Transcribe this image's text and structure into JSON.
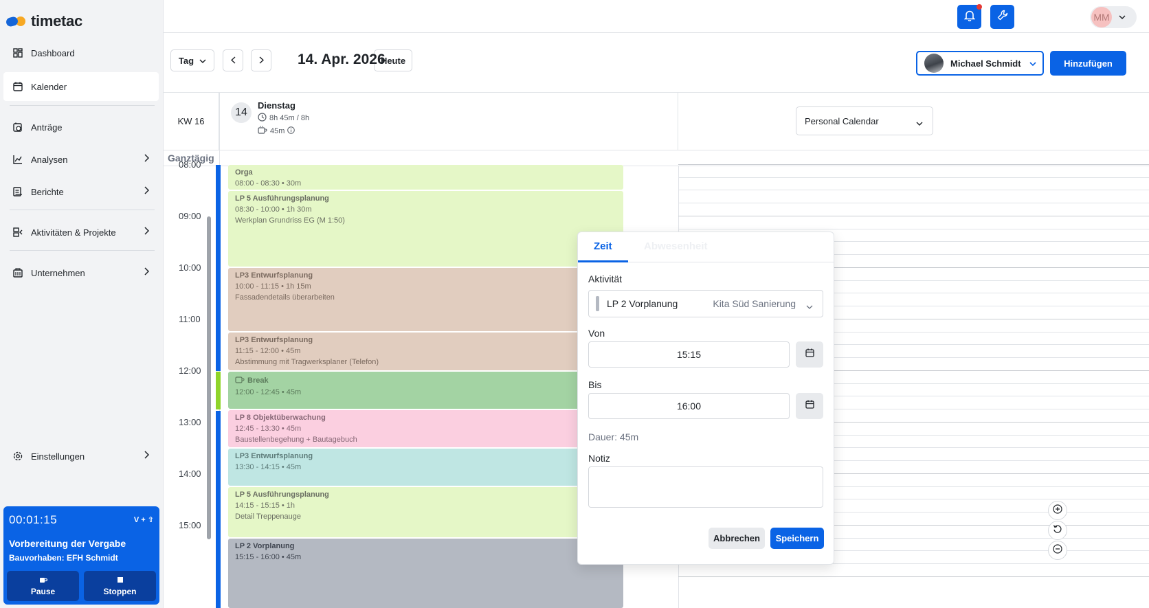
{
  "app": {
    "name": "timetac"
  },
  "sidebar": {
    "items": [
      {
        "label": "Dashboard",
        "icon": "dashboard-icon"
      },
      {
        "label": "Kalender",
        "icon": "calendar-icon"
      },
      {
        "label": "Anträge",
        "icon": "request-icon"
      },
      {
        "label": "Analysen",
        "icon": "chart-icon"
      },
      {
        "label": "Berichte",
        "icon": "report-icon"
      },
      {
        "label": "Aktivitäten & Projekte",
        "icon": "projects-icon"
      },
      {
        "label": "Unternehmen",
        "icon": "company-icon"
      },
      {
        "label": "Einstellungen",
        "icon": "settings-icon"
      }
    ]
  },
  "timer": {
    "elapsed": "00:01:15",
    "shortcut": "V + ⇧",
    "task": "Vorbereitung der Vergabe",
    "project": "Bauvorhaben: EFH Schmidt",
    "pause_label": "Pause",
    "stop_label": "Stoppen"
  },
  "topbar": {
    "user_initials": "MM"
  },
  "toolbar": {
    "view": "Tag",
    "date": "14. Apr. 2026",
    "today_label": "Heute",
    "user_name": "Michael Schmidt",
    "add_label": "Hinzufügen"
  },
  "calendar": {
    "week": "KW 16",
    "day_number": "14",
    "day_name": "Dienstag",
    "hours_summary": "8h 45m / 8h",
    "break_summary": "45m",
    "calendar_select": "Personal Calendar",
    "allday_label": "Ganztägig",
    "hours": [
      "08:00",
      "09:00",
      "10:00",
      "11:00",
      "12:00",
      "13:00",
      "14:00",
      "15:00"
    ],
    "events": [
      {
        "title": "Orga",
        "time": "08:00 - 08:30 • 30m",
        "note": "",
        "style": "green"
      },
      {
        "title": "LP 5 Ausführungsplanung",
        "time": "08:30 - 10:00 • 1h 30m",
        "note": "Werkplan Grundriss EG (M 1:50)",
        "style": "green"
      },
      {
        "title": "LP3 Entwurfsplanung",
        "time": "10:00 - 11:15 • 1h 15m",
        "note": "Fassadendetails überarbeiten",
        "style": "brown"
      },
      {
        "title": "LP3 Entwurfsplanung",
        "time": "11:15 - 12:00 • 45m",
        "note": "Abstimmung mit Tragwerksplaner (Telefon)",
        "style": "brown"
      },
      {
        "title": "Break",
        "time": "12:00 - 12:45 • 45m",
        "note": "",
        "style": "break"
      },
      {
        "title": "LP 8 Objektüberwachung",
        "time": "12:45 - 13:30 • 45m",
        "note": "Baustellenbegehung + Bautagebuch",
        "style": "pink"
      },
      {
        "title": "LP3 Entwurfsplanung",
        "time": "13:30 - 14:15 • 45m",
        "note": "",
        "style": "teal"
      },
      {
        "title": "LP 5 Ausführungsplanung",
        "time": "14:15 - 15:15 • 1h",
        "note": "Detail Treppenauge",
        "style": "green"
      },
      {
        "title": "LP 2 Vorplanung",
        "time": "15:15 - 16:00 • 45m",
        "note": "",
        "style": "gray"
      }
    ]
  },
  "popup": {
    "tab_time": "Zeit",
    "tab_absence": "Abwesenheit",
    "activity_label": "Aktivität",
    "activity_value": "LP 2 Vorplanung",
    "activity_project": "Kita Süd Sanierung",
    "from_label": "Von",
    "from_value": "15:15",
    "to_label": "Bis",
    "to_value": "16:00",
    "duration": "Dauer: 45m",
    "note_label": "Notiz",
    "note_value": "",
    "cancel_label": "Abbrechen",
    "save_label": "Speichern"
  },
  "colors": {
    "accent": "#0a63e5",
    "event_green": "#e5f7c7",
    "event_brown": "#e1cdbf",
    "event_break": "#a3d3a3",
    "event_pink": "#fbcfe0",
    "event_teal": "#bfe6e3",
    "event_gray": "#b4b9c2"
  }
}
